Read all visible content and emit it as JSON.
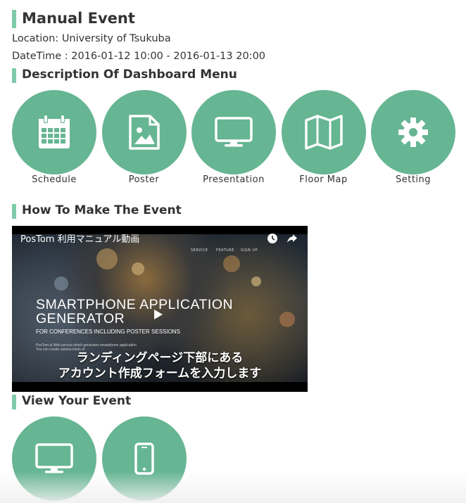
{
  "event": {
    "title": "Manual Event",
    "location": "Location: University of Tsukuba",
    "datetime": "DateTime : 2016-01-12 10:00 - 2016-01-13 20:00"
  },
  "dashboard": {
    "heading": "Description Of Dashboard Menu",
    "items": [
      {
        "label": "Schedule",
        "icon": "calendar-icon"
      },
      {
        "label": "Poster",
        "icon": "image-file-icon"
      },
      {
        "label": "Presentation",
        "icon": "monitor-icon"
      },
      {
        "label": "Floor Map",
        "icon": "map-icon"
      },
      {
        "label": "Setting",
        "icon": "gear-icon"
      }
    ]
  },
  "howto": {
    "heading": "How To Make The Event",
    "video": {
      "title": "PosTom 利用マニュアル動画",
      "nav": [
        "SERVICE",
        "FEATURE",
        "SIGN UP"
      ],
      "headline_1": "SMARTPHONE APPLICATION",
      "headline_2": "GENERATOR",
      "subline": "FOR CONFERENCES INCLUDING POSTER SESSIONS",
      "small_1": "PosTom is Web service which generates smartphone application",
      "small_2": "You can create various kinds of",
      "caption_1": "ランディングページ下部にある",
      "caption_2": "アカウント作成フォームを入力します"
    }
  },
  "view": {
    "heading": "View Your Event",
    "items": [
      {
        "label": "",
        "icon": "monitor-icon"
      },
      {
        "label": "",
        "icon": "smartphone-icon"
      }
    ]
  },
  "colors": {
    "accent": "#66b593",
    "heading_bar": "#7fcbaa",
    "text": "#333333"
  }
}
